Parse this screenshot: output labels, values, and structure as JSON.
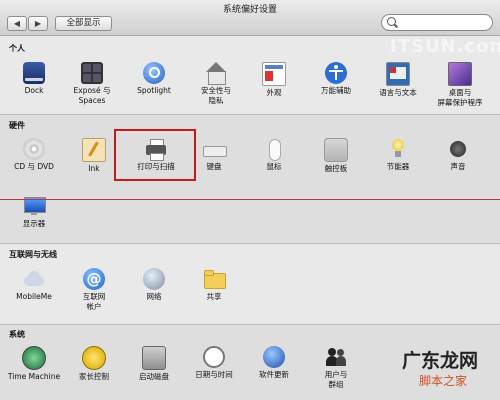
{
  "window": {
    "title": "系统偏好设置"
  },
  "toolbar": {
    "back_label": "◀",
    "forward_label": "▶",
    "show_all_label": "全部显示"
  },
  "search": {
    "value": "",
    "placeholder": ""
  },
  "sections": {
    "personal": {
      "title": "个人",
      "items": [
        {
          "label": "Dock",
          "icon": "dock-icon"
        },
        {
          "label": "Exposé 与\nSpaces",
          "icon": "expose-spaces-icon"
        },
        {
          "label": "Spotlight",
          "icon": "spotlight-icon"
        },
        {
          "label": "安全性与\n隐私",
          "icon": "security-house-icon"
        },
        {
          "label": "外观",
          "icon": "appearance-icon"
        },
        {
          "label": "万能辅助",
          "icon": "universal-access-icon"
        },
        {
          "label": "语言与文本",
          "icon": "language-flag-icon"
        },
        {
          "label": "桌面与\n屏幕保护程序",
          "icon": "desktop-screensaver-icon"
        }
      ]
    },
    "hardware": {
      "title": "硬件",
      "items": [
        {
          "label": "CD 与 DVD",
          "icon": "cd-dvd-icon"
        },
        {
          "label": "Ink",
          "icon": "ink-icon"
        },
        {
          "label": "打印与扫描",
          "icon": "printer-icon"
        },
        {
          "label": "键盘",
          "icon": "keyboard-icon"
        },
        {
          "label": "鼠标",
          "icon": "mouse-icon"
        },
        {
          "label": "触控板",
          "icon": "trackpad-icon"
        },
        {
          "label": "节能器",
          "icon": "energy-bulb-icon"
        },
        {
          "label": "声音",
          "icon": "speaker-icon"
        },
        {
          "label": "显示器",
          "icon": "display-icon"
        }
      ]
    },
    "internet": {
      "title": "互联网与无线",
      "items": [
        {
          "label": "MobileMe",
          "icon": "mobileme-icon"
        },
        {
          "label": "互联网\n帐户",
          "icon": "internet-accounts-icon"
        },
        {
          "label": "网络",
          "icon": "network-globe-icon"
        },
        {
          "label": "共享",
          "icon": "sharing-folder-icon"
        }
      ]
    },
    "system": {
      "title": "系统",
      "items": [
        {
          "label": "Time Machine",
          "icon": "time-machine-icon"
        },
        {
          "label": "家长控制",
          "icon": "parental-controls-icon"
        },
        {
          "label": "启动磁盘",
          "icon": "startup-disk-icon"
        },
        {
          "label": "日期与时间",
          "icon": "date-time-icon"
        },
        {
          "label": "软件更新",
          "icon": "software-update-icon"
        },
        {
          "label": "用户与\n群组",
          "icon": "users-groups-icon"
        }
      ]
    }
  },
  "watermarks": {
    "top": "ITSUN.com",
    "brand": "广东龙网",
    "site": "脚本之家"
  },
  "colors": {
    "highlight": "#c31b1b"
  }
}
